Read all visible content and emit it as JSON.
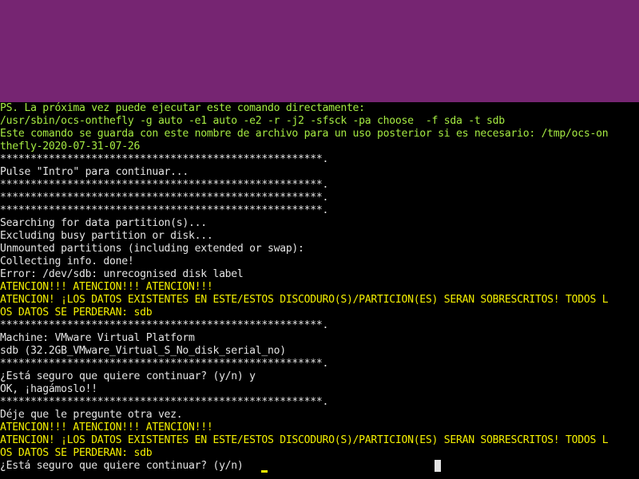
{
  "colors": {
    "banner_background": "#762572",
    "terminal_background": "#000000",
    "text_default": "#e4e4e4",
    "text_green": "#a5ea42",
    "text_yellow": "#f4f000",
    "cursor_yellow": "#f4f000",
    "scroll_indicator": "#e4e4e4"
  },
  "terminal": {
    "lines": [
      {
        "text": "PS. La próxima vez puede ejecutar este comando directamente:",
        "color": "green"
      },
      {
        "text": "/usr/sbin/ocs-onthefly -g auto -e1 auto -e2 -r -j2 -sfsck -pa choose  -f sda -t sdb",
        "color": "green"
      },
      {
        "text": "Este comando se guarda con este nombre de archivo para un uso posterior si es necesario: /tmp/ocs-on",
        "color": "green"
      },
      {
        "text": "thefly-2020-07-31-07-26",
        "color": "green"
      },
      {
        "text": "*****************************************************.",
        "color": "default"
      },
      {
        "text": "Pulse \"Intro\" para continuar...",
        "color": "default"
      },
      {
        "text": "*****************************************************.",
        "color": "default"
      },
      {
        "text": "*****************************************************.",
        "color": "default"
      },
      {
        "text": "*****************************************************.",
        "color": "default"
      },
      {
        "text": "Searching for data partition(s)...",
        "color": "default"
      },
      {
        "text": "Excluding busy partition or disk...",
        "color": "default"
      },
      {
        "text": "Unmounted partitions (including extended or swap):",
        "color": "default"
      },
      {
        "text": "Collecting info. done!",
        "color": "default"
      },
      {
        "text": "Error: /dev/sdb: unrecognised disk label",
        "color": "default"
      },
      {
        "text": "ATENCIÓN!!! ATENCIÓN!!! ATENCIÓN!!!",
        "color": "yellow"
      },
      {
        "text": "ATENCIÓN! ¡LOS DATOS EXISTENTES EN ESTE/ESTOS DISCODURO(S)/PARTICION(ES) SERÁN SOBRESCRITOS! TODOS L",
        "color": "yellow"
      },
      {
        "text": "OS DATOS SE PERDERÁN: sdb",
        "color": "yellow"
      },
      {
        "text": "*****************************************************.",
        "color": "default"
      },
      {
        "text": "Machine: VMware Virtual Platform",
        "color": "default"
      },
      {
        "text": "sdb (32.2GB_VMware_Virtual_S_No_disk_serial_no)",
        "color": "default"
      },
      {
        "text": "*****************************************************.",
        "color": "default"
      },
      {
        "text": "¿Está seguro que quiere continuar? (y/n) y",
        "color": "default"
      },
      {
        "text": "OK, ¡hagámoslo!!",
        "color": "default"
      },
      {
        "text": "*****************************************************.",
        "color": "default"
      },
      {
        "text": "Déje que le pregunte otra vez.",
        "color": "default"
      },
      {
        "text": "ATENCIÓN!!! ATENCIÓN!!! ATENCIÓN!!!",
        "color": "yellow"
      },
      {
        "text": "ATENCIÓN! ¡LOS DATOS EXISTENTES EN ESTE/ESTOS DISCODURO(S)/PARTICION(ES) SERÁN SOBRESCRITOS! TODOS L",
        "color": "yellow"
      },
      {
        "text": "OS DATOS SE PERDERÁN: sdb",
        "color": "yellow"
      },
      {
        "text": "¿Está seguro que quiere continuar? (y/n) ",
        "color": "default"
      }
    ]
  }
}
